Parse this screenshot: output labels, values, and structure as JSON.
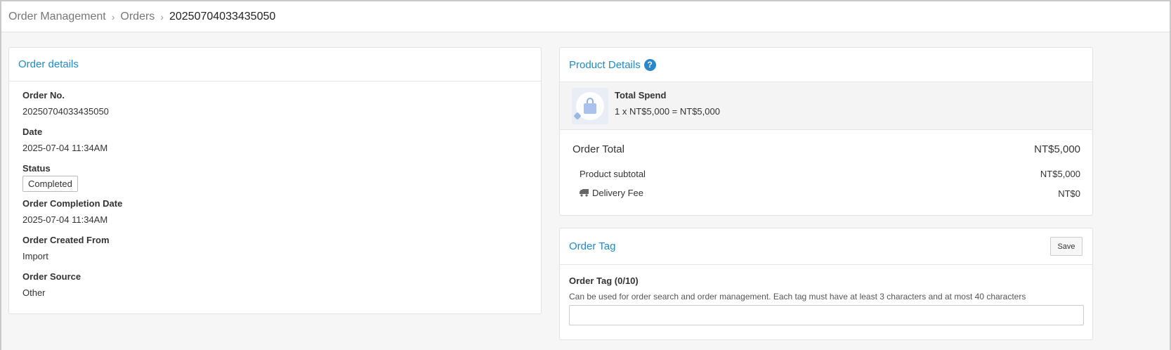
{
  "breadcrumb": {
    "items": [
      "Order Management",
      "Orders"
    ],
    "current": "20250704033435050"
  },
  "order_details": {
    "title": "Order details",
    "fields": [
      {
        "label": "Order No.",
        "value": "20250704033435050"
      },
      {
        "label": "Date",
        "value": "2025-07-04 11:34AM"
      },
      {
        "label": "Status",
        "value": "Completed"
      },
      {
        "label": "Order Completion Date",
        "value": "2025-07-04 11:34AM"
      },
      {
        "label": "Order Created From",
        "value": "Import"
      },
      {
        "label": "Order Source",
        "value": "Other"
      }
    ]
  },
  "product_details": {
    "title": "Product Details",
    "help_icon": "question-circle-icon",
    "product": {
      "name": "Total Spend",
      "line": "1 x NT$5,000 = NT$5,000",
      "icon": "shopping-bag-icon"
    },
    "order_total_label": "Order Total",
    "order_total_value": "NT$5,000",
    "subtotal_label": "Product subtotal",
    "subtotal_value": "NT$5,000",
    "delivery_label": "Delivery Fee",
    "delivery_value": "NT$0",
    "delivery_icon": "truck-icon"
  },
  "order_tag": {
    "title": "Order Tag",
    "save_label": "Save",
    "field_label": "Order Tag (0/10)",
    "description": "Can be used for order search and order management. Each tag must have at least 3 characters and at most 40 characters",
    "input_value": ""
  },
  "colors": {
    "accent": "#1e8bc8",
    "help_icon": "#2a87c8",
    "product_bg": "#f4f4f4"
  }
}
